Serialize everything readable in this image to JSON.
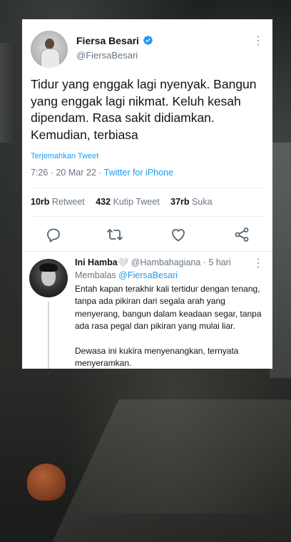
{
  "tweet": {
    "author_name": "Fiersa Besari",
    "author_handle": "@FiersaBesari",
    "text": "Tidur yang enggak lagi nyenyak. Bangun yang enggak lagi nikmat. Keluh kesah dipendam. Rasa sakit didiamkan. Kemudian, terbiasa",
    "translate_label": "Terjemahkan Tweet",
    "time": "7:26",
    "date": "20 Mar 22",
    "separator": "·",
    "source": "Twitter for iPhone",
    "stats": {
      "retweets_count": "10rb",
      "retweets_label": "Retweet",
      "quotes_count": "432",
      "quotes_label": "Kutip Tweet",
      "likes_count": "37rb",
      "likes_label": "Suka"
    },
    "icons": [
      "verified-badge-icon",
      "more-vertical-icon",
      "reply-icon",
      "retweet-icon",
      "like-icon",
      "share-icon"
    ],
    "colors": {
      "accent": "#1d9bf0",
      "secondary_text": "#687684",
      "text": "#0f1419"
    }
  },
  "reply": {
    "name": "Ini Hamba🤍",
    "handle": "@Hambahagiana",
    "separator": "·",
    "age": "5 hari",
    "replying_label": "Membalas",
    "replying_to": "@FiersaBesari",
    "paragraph_1": "Entah kapan terakhir kali tertidur dengan tenang, tanpa ada pikiran dari segala arah yang menyerang, bangun dalam keadaan segar, tanpa ada rasa pegal dan pikiran yang mulai liar.",
    "paragraph_2": "Dewasa ini kukira menyenangkan, ternyata menyeramkan."
  }
}
